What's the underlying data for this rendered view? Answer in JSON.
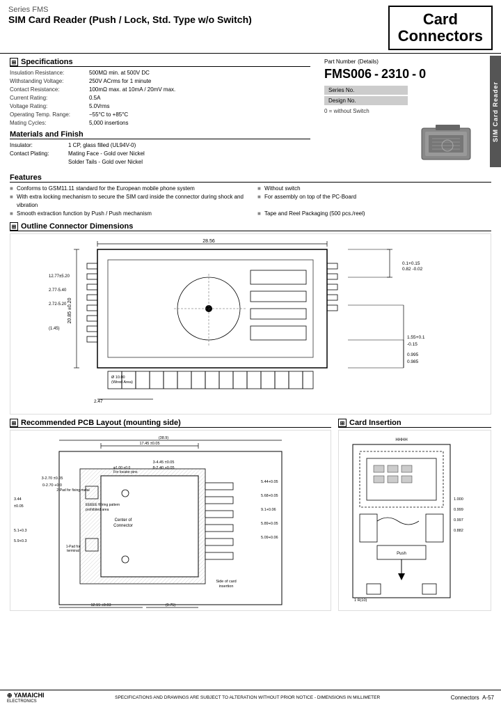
{
  "header": {
    "series": "Series FMS",
    "title": "SIM Card Reader (Push / Lock, Std. Type w/o Switch)",
    "card_title": "Card",
    "conn_title": "Connectors"
  },
  "side_label": "SIM Card Reader",
  "specs": {
    "title": "Specifications",
    "items": [
      {
        "label": "Insulation Resistance:",
        "value": "500MΩ min. at 500V DC"
      },
      {
        "label": "Withstanding Voltage:",
        "value": "250V ACrms for 1 minute"
      },
      {
        "label": "Contact Resistance:",
        "value": "100mΩ max. at 10mA / 20mV max."
      },
      {
        "label": "Current Rating:",
        "value": "0.5A"
      },
      {
        "label": "Voltage Rating:",
        "value": "5.0Vrms"
      },
      {
        "label": "Operating Temp. Range:",
        "value": "−55°C to +85°C"
      },
      {
        "label": "Mating Cycles:",
        "value": "5,000 insertions"
      }
    ]
  },
  "materials": {
    "title": "Materials and Finish",
    "items": [
      {
        "label": "Insulator:",
        "value": "1 CP, glass filled (UL94V-0)"
      },
      {
        "label": "Contact Plating:",
        "value": "Mating Face - Gold over Nickel"
      },
      {
        "label": "",
        "value": "Solder Tails - Gold over Nickel"
      }
    ]
  },
  "features": {
    "title": "Features",
    "items": [
      "Conforms to GSM11.11 standard for the European mobile phone system",
      "Without switch",
      "With extra locking mechanism to secure the SIM card inside the connector during shock and vibration",
      "For assembly on top of the PC-Board",
      "Smooth extraction function by Push / Push mechanism",
      "Tape and Reel Packaging (500 pcs./reel)"
    ]
  },
  "part_number": {
    "title": "Part Number",
    "subtitle": "(Details)",
    "code": "FMS006",
    "separator1": "-",
    "design": "2310",
    "separator2": "-",
    "variant": "0",
    "labels": [
      "Series No.",
      "Design No.",
      "0 = without Switch"
    ]
  },
  "outline": {
    "title": "Outline Connector Dimensions"
  },
  "pcb": {
    "title": "Recommended PCB Layout (mounting side)"
  },
  "card_insertion": {
    "title": "Card Insertion"
  },
  "footer": {
    "logo": "⊕ YAMAICHI",
    "sub_logo": "ELECTRONICS",
    "text": "SPECIFICATIONS AND DRAWINGS ARE SUBJECT TO ALTERATION WITHOUT PRIOR NOTICE - DIMENSIONS IN MILLIMETER",
    "page_label": "Connectors",
    "page_number": "A-57"
  }
}
